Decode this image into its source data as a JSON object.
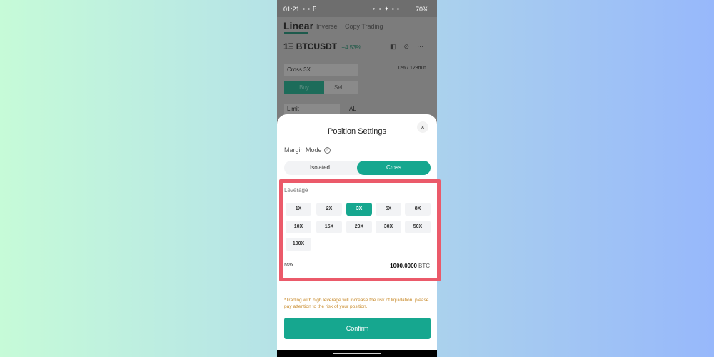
{
  "status_bar": {
    "time": "01:21",
    "left_icons": "▪ ▪ P",
    "right_icons": "⚬ ▪ ✦ ▪ ▪",
    "battery": "70%"
  },
  "background_app": {
    "tabs": [
      {
        "label": "Linear",
        "active": true
      },
      {
        "label": "Inverse",
        "active": false
      },
      {
        "label": "Copy Trading",
        "active": false
      }
    ],
    "pair_icon": "1Ξ",
    "pair": "BTCUSDT",
    "change": "+4.53%",
    "margin_select": "Cross 3X",
    "timer": "0% / 128min",
    "buy_label": "Buy",
    "sell_label": "Sell",
    "order_type": "Limit",
    "al_label": "AL"
  },
  "sheet": {
    "title": "Position Settings",
    "close_icon": "×",
    "margin_mode_label": "Margin Mode",
    "help_icon": "?",
    "modes": {
      "isolated": "Isolated",
      "cross": "Cross",
      "selected": "Cross"
    },
    "leverage_label": "Leverage",
    "leverage_options": [
      "1X",
      "2X",
      "3X",
      "5X",
      "8X",
      "10X",
      "15X",
      "20X",
      "30X",
      "50X",
      "100X"
    ],
    "leverage_selected": "3X",
    "max_label": "Max",
    "max_value": "1000.0000",
    "max_unit": "BTC",
    "warning": "*Trading with high leverage will increase the risk of liquidation, please pay attention to the risk of your position.",
    "confirm_label": "Confirm"
  },
  "colors": {
    "accent": "#16a78f",
    "highlight": "#eb5a6a",
    "warning": "#c88a2a"
  }
}
